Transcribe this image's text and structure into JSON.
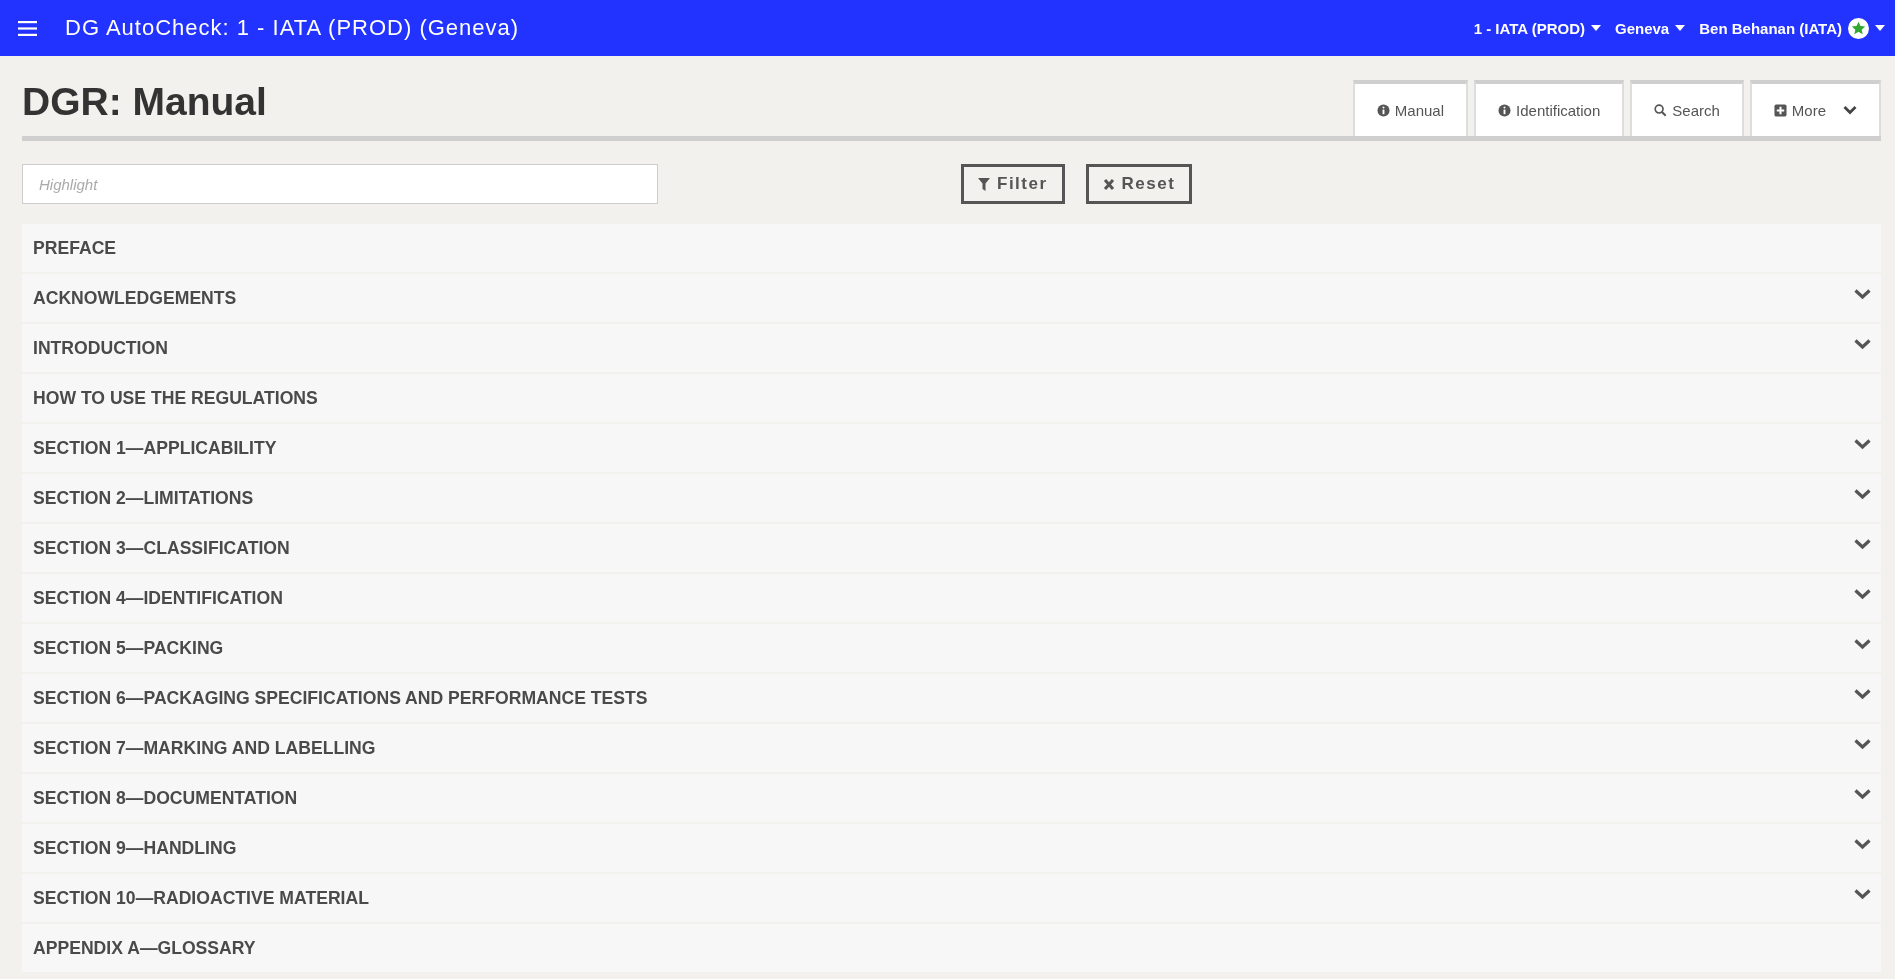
{
  "top_bar": {
    "title": "DG AutoCheck: 1 - IATA (PROD) (Geneva)",
    "menus": [
      {
        "label": "1 - IATA (PROD)",
        "kind": "text"
      },
      {
        "label": "Geneva",
        "kind": "text"
      },
      {
        "label": "Ben Behanan (IATA)",
        "kind": "user"
      }
    ]
  },
  "page": {
    "title": "DGR: Manual",
    "tabs": [
      {
        "label": "Manual",
        "kind": "info",
        "selected": false
      },
      {
        "label": "Identification",
        "kind": "info",
        "selected": false
      },
      {
        "label": "Search",
        "kind": "search",
        "selected": false
      },
      {
        "label": "More",
        "kind": "more",
        "selected": false
      }
    ]
  },
  "filter_bar": {
    "highlight": {
      "placeholder": "Highlight"
    },
    "buttons": [
      {
        "label": "Filter",
        "kind": "filter"
      },
      {
        "label": "Reset",
        "kind": "reset"
      }
    ]
  },
  "sections": [
    {
      "title": "PREFACE",
      "expandable": false
    },
    {
      "title": "ACKNOWLEDGEMENTS",
      "expandable": true
    },
    {
      "title": "INTRODUCTION",
      "expandable": true
    },
    {
      "title": "HOW TO USE THE REGULATIONS",
      "expandable": false
    },
    {
      "title": "SECTION 1—APPLICABILITY",
      "expandable": true
    },
    {
      "title": "SECTION 2—LIMITATIONS",
      "expandable": true
    },
    {
      "title": "SECTION 3—CLASSIFICATION",
      "expandable": true
    },
    {
      "title": "SECTION 4—IDENTIFICATION",
      "expandable": true
    },
    {
      "title": "SECTION 5—PACKING",
      "expandable": true
    },
    {
      "title": "SECTION 6—PACKAGING SPECIFICATIONS AND PERFORMANCE TESTS",
      "expandable": true
    },
    {
      "title": "SECTION 7—MARKING AND LABELLING",
      "expandable": true
    },
    {
      "title": "SECTION 8—DOCUMENTATION",
      "expandable": true
    },
    {
      "title": "SECTION 9—HANDLING",
      "expandable": true
    },
    {
      "title": "SECTION 10—RADIOACTIVE MATERIAL",
      "expandable": true
    },
    {
      "title": "APPENDIX A—GLOSSARY",
      "expandable": false
    }
  ]
}
